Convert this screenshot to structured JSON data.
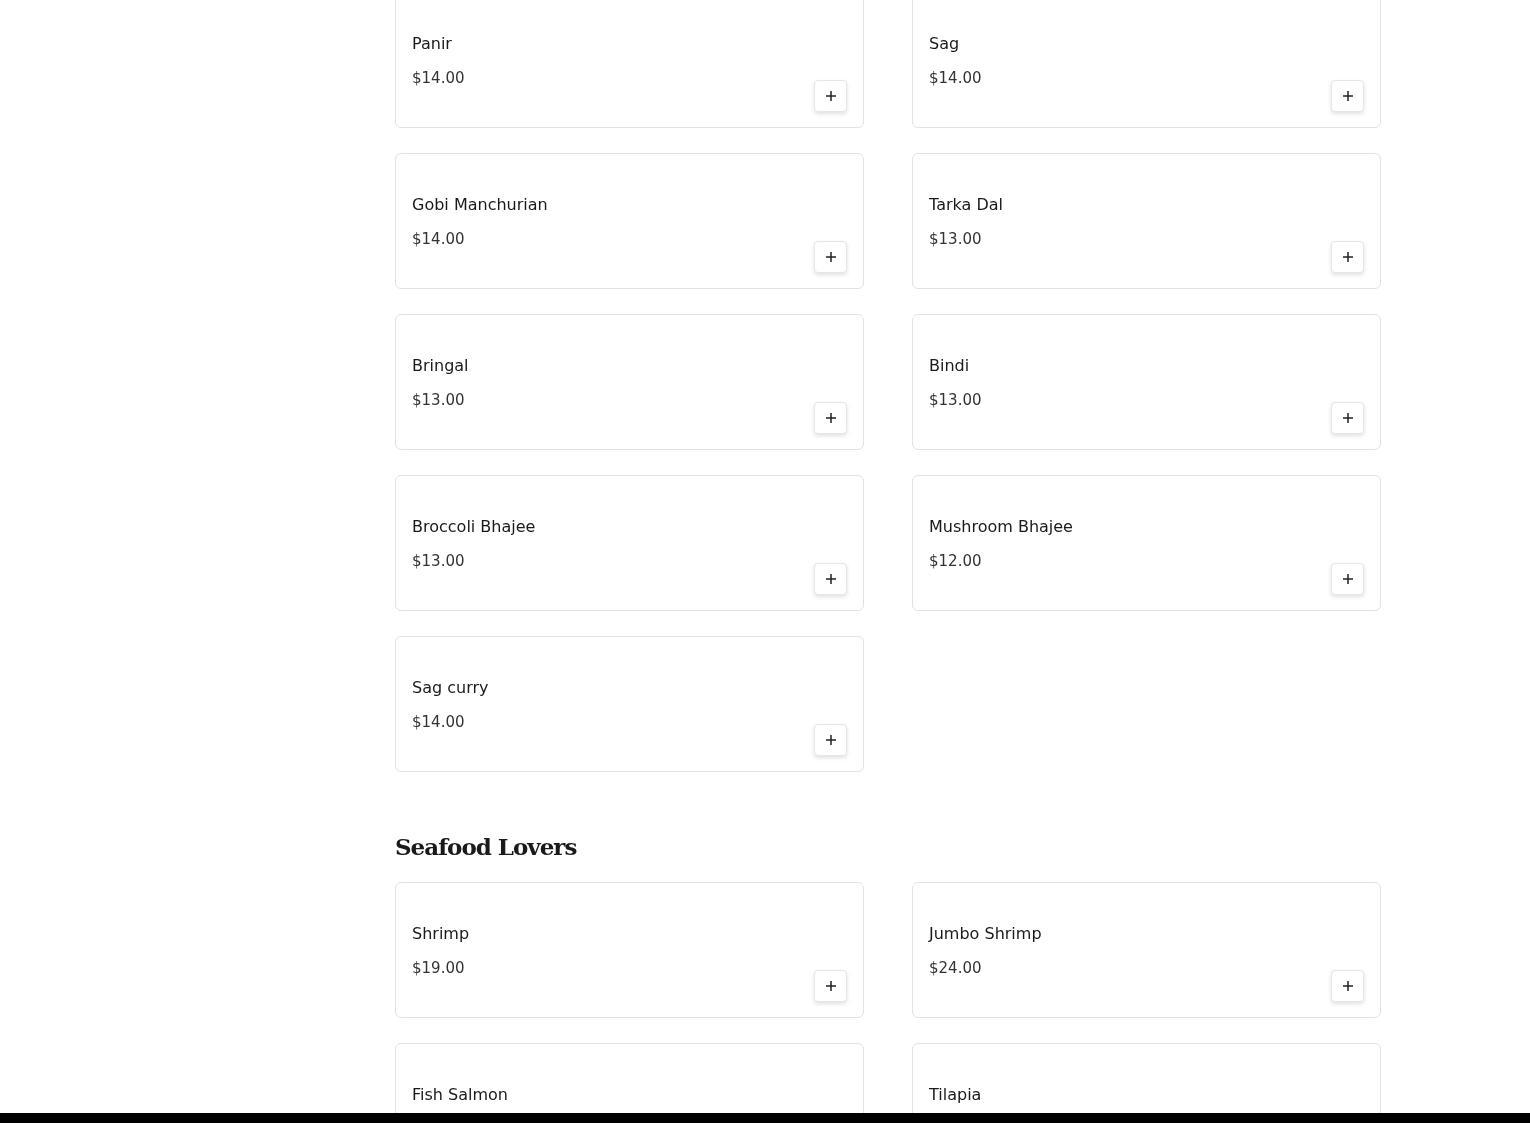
{
  "sections": [
    {
      "items": [
        {
          "name": "Panir",
          "price": "$14.00"
        },
        {
          "name": "Sag",
          "price": "$14.00"
        },
        {
          "name": "Gobi Manchurian",
          "price": "$14.00"
        },
        {
          "name": "Tarka Dal",
          "price": "$13.00"
        },
        {
          "name": "Bringal",
          "price": "$13.00"
        },
        {
          "name": "Bindi",
          "price": "$13.00"
        },
        {
          "name": "Broccoli Bhajee",
          "price": "$13.00"
        },
        {
          "name": "Mushroom Bhajee",
          "price": "$12.00"
        },
        {
          "name": "Sag curry",
          "price": "$14.00"
        }
      ]
    },
    {
      "title": "Seafood Lovers",
      "items": [
        {
          "name": "Shrimp",
          "price": "$19.00"
        },
        {
          "name": "Jumbo Shrimp",
          "price": "$24.00"
        },
        {
          "name": "Fish Salmon"
        },
        {
          "name": "Tilapia"
        }
      ]
    }
  ]
}
